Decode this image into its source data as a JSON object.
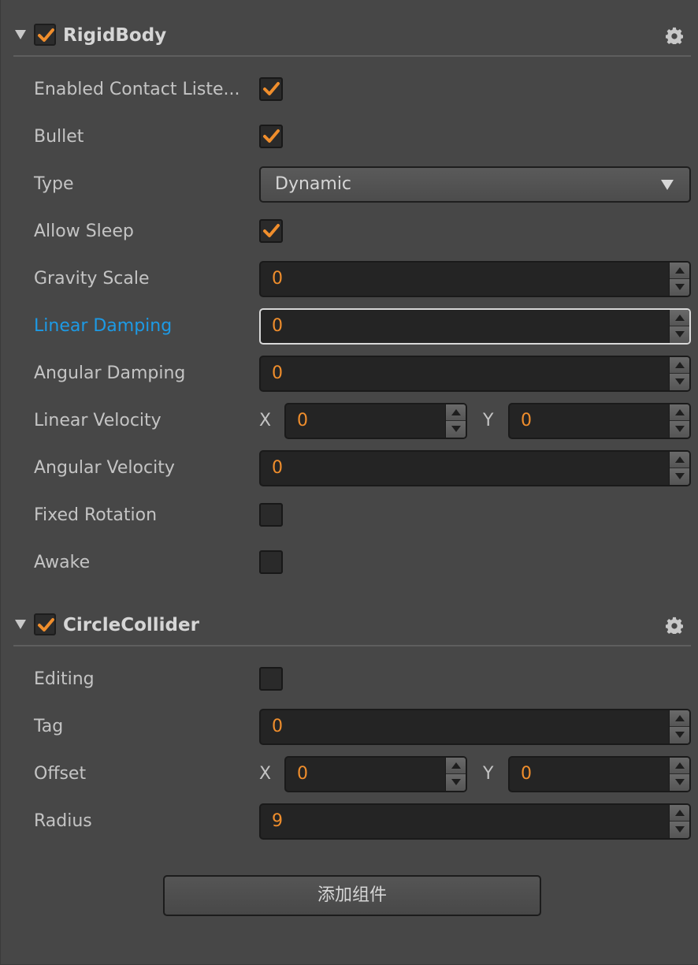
{
  "rigidbody": {
    "title": "RigidBody",
    "enabled": true,
    "enabled_contact_listener_label": "Enabled Contact Liste...",
    "enabled_contact_listener": true,
    "bullet_label": "Bullet",
    "bullet": true,
    "type_label": "Type",
    "type_value": "Dynamic",
    "allow_sleep_label": "Allow Sleep",
    "allow_sleep": true,
    "gravity_scale_label": "Gravity Scale",
    "gravity_scale": "0",
    "linear_damping_label": "Linear Damping",
    "linear_damping": "0",
    "angular_damping_label": "Angular Damping",
    "angular_damping": "0",
    "linear_velocity_label": "Linear Velocity",
    "linear_velocity_x_label": "X",
    "linear_velocity_x": "0",
    "linear_velocity_y_label": "Y",
    "linear_velocity_y": "0",
    "angular_velocity_label": "Angular Velocity",
    "angular_velocity": "0",
    "fixed_rotation_label": "Fixed Rotation",
    "fixed_rotation": false,
    "awake_label": "Awake",
    "awake": false
  },
  "circlecollider": {
    "title": "CircleCollider",
    "enabled": true,
    "editing_label": "Editing",
    "editing": false,
    "tag_label": "Tag",
    "tag": "0",
    "offset_label": "Offset",
    "offset_x_label": "X",
    "offset_x": "0",
    "offset_y_label": "Y",
    "offset_y": "0",
    "radius_label": "Radius",
    "radius": "9"
  },
  "add_component_label": "添加组件",
  "colors": {
    "accent_orange": "#f08e2c",
    "active_label_blue": "#1d9ae5",
    "panel_bg": "#474747",
    "field_bg": "#242424"
  }
}
